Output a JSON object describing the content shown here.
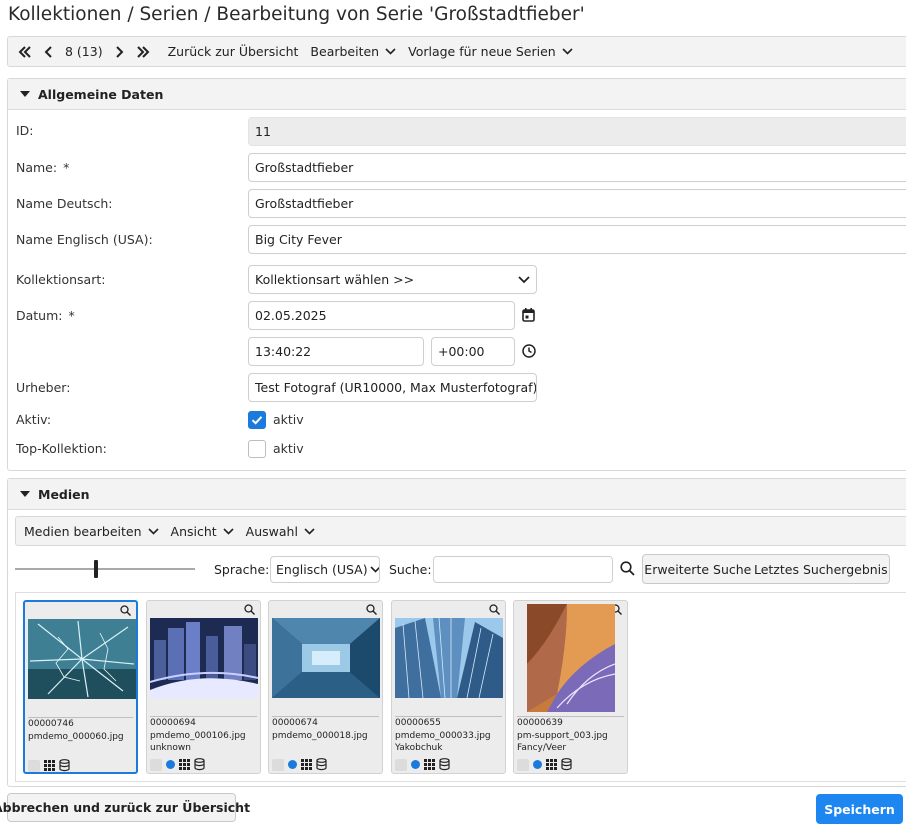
{
  "breadcrumb": "Kollektionen / Serien / Bearbeitung von Serie 'Großstadtfieber'",
  "toolbar": {
    "pager": "8 (13)",
    "back_label": "Zurück zur Übersicht",
    "edit_label": "Bearbeiten",
    "template_label": "Vorlage für neue Serien"
  },
  "general": {
    "heading": "Allgemeine Daten",
    "id_label": "ID:",
    "id_value": "11",
    "name_label": "Name:",
    "required_mark": "*",
    "name_value": "Großstadtfieber",
    "name_de_label": "Name Deutsch:",
    "name_de_value": "Großstadtfieber",
    "name_en_label": "Name Englisch (USA):",
    "name_en_value": "Big City Fever",
    "kind_label": "Kollektionsart:",
    "kind_value": "Kollektionsart wählen >>",
    "date_label": "Datum:",
    "date_value": "02.05.2025",
    "time_value": "13:40:22",
    "tz_value": "+00:00",
    "author_label": "Urheber:",
    "author_value": "Test Fotograf (UR10000, Max Musterfotograf)",
    "active_label": "Aktiv:",
    "active_checked": true,
    "active_text": "aktiv",
    "top_label": "Top-Kollektion:",
    "top_checked": false,
    "top_text": "aktiv"
  },
  "media": {
    "heading": "Medien",
    "menu_edit": "Medien bearbeiten",
    "menu_view": "Ansicht",
    "menu_select": "Auswahl",
    "slider_level": 0.45,
    "lang_label": "Sprache:",
    "lang_value": "Englisch (USA)",
    "search_label": "Suche:",
    "search_value": "",
    "advanced_search": "Erweiterte Suche",
    "last_result": "Letztes Suchergebnis",
    "items": [
      {
        "number": "00000746",
        "file": "pmdemo_000060.jpg",
        "author": "",
        "selected": true,
        "has_status": false
      },
      {
        "number": "00000694",
        "file": "pmdemo_000106.jpg",
        "author": "unknown",
        "selected": false,
        "has_status": true
      },
      {
        "number": "00000674",
        "file": "pmdemo_000018.jpg",
        "author": "",
        "selected": false,
        "has_status": true
      },
      {
        "number": "00000655",
        "file": "pmdemo_000033.jpg",
        "author": "Yakobchuk",
        "selected": false,
        "has_status": true
      },
      {
        "number": "00000639",
        "file": "pm-support_003.jpg",
        "author": "Fancy/Veer",
        "selected": false,
        "has_status": true
      }
    ]
  },
  "footer": {
    "cancel_label": "Abbrechen und zurück zur Übersicht",
    "save_label": "Speichern"
  },
  "colors": {
    "accent": "#1d86f0",
    "panel_header": "#f3f3f3"
  }
}
